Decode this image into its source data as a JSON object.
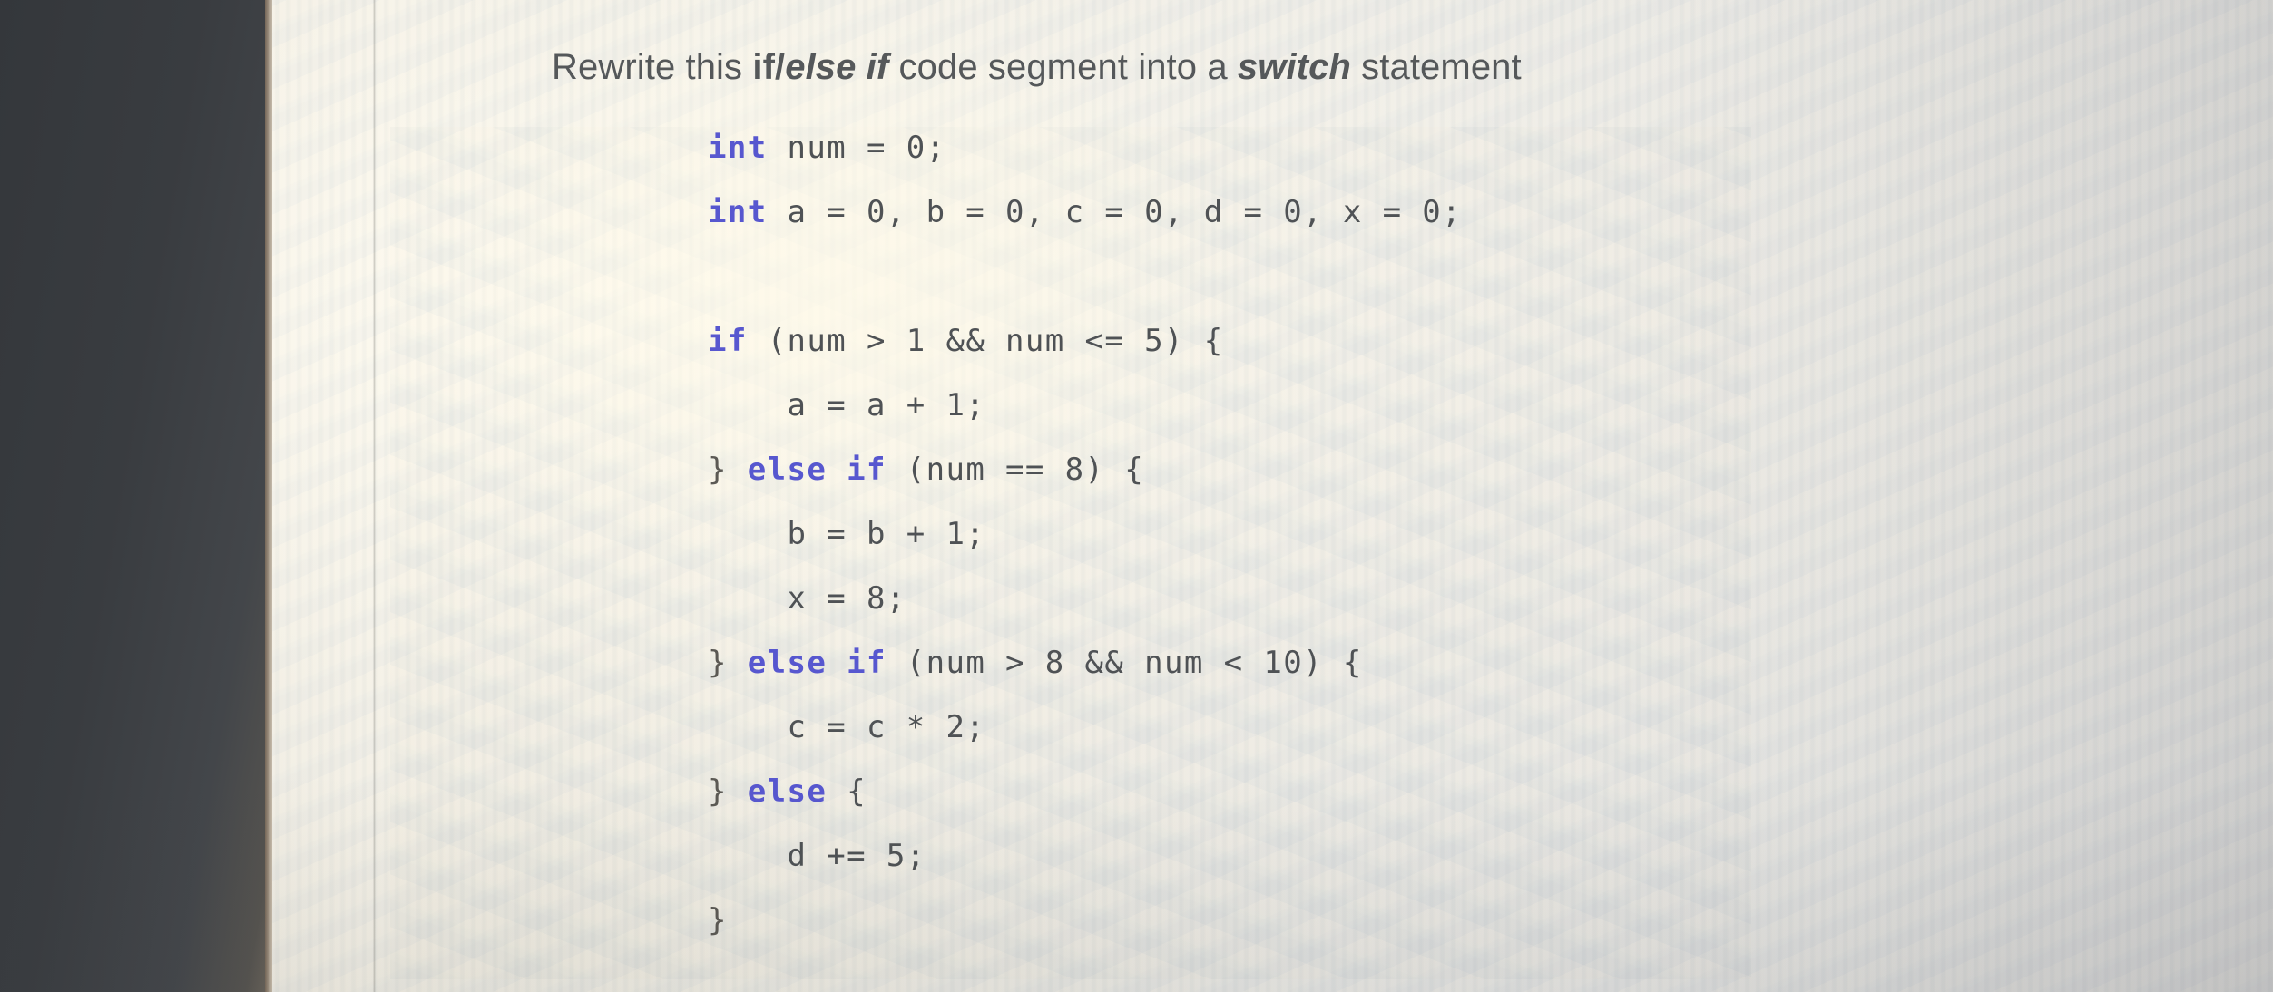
{
  "document": {
    "kind": "photo-of-screen-code-question",
    "question": {
      "prefix": "Rewrite this ",
      "kw1": "if",
      "slash": "/",
      "kw2": "else if",
      "middle": " code segment into a ",
      "kw3": "switch",
      "suffix": " statement"
    },
    "code": {
      "language": "java",
      "lines": [
        {
          "indent": 0,
          "segments": [
            {
              "t": "int",
              "c": "kw"
            },
            {
              "t": " num = 0;",
              "c": "tok"
            }
          ]
        },
        {
          "indent": 0,
          "segments": [
            {
              "t": "int",
              "c": "kw"
            },
            {
              "t": " a = 0, b = 0, c = 0, d = 0, x = 0;",
              "c": "tok"
            }
          ]
        },
        {
          "indent": 0,
          "segments": []
        },
        {
          "indent": 0,
          "segments": [
            {
              "t": "if",
              "c": "kw"
            },
            {
              "t": " (num > 1 && num <= 5) {",
              "c": "tok"
            }
          ]
        },
        {
          "indent": 4,
          "segments": [
            {
              "t": "a = a + 1;",
              "c": "tok"
            }
          ]
        },
        {
          "indent": 0,
          "segments": [
            {
              "t": "}",
              "c": "brace"
            },
            {
              "t": " ",
              "c": "tok"
            },
            {
              "t": "else if",
              "c": "kw"
            },
            {
              "t": " (num == 8) {",
              "c": "tok"
            }
          ]
        },
        {
          "indent": 4,
          "segments": [
            {
              "t": "b = b + 1;",
              "c": "tok"
            }
          ]
        },
        {
          "indent": 4,
          "segments": [
            {
              "t": "x = 8;",
              "c": "tok"
            }
          ]
        },
        {
          "indent": 0,
          "segments": [
            {
              "t": "}",
              "c": "brace"
            },
            {
              "t": " ",
              "c": "tok"
            },
            {
              "t": "else if",
              "c": "kw"
            },
            {
              "t": " (num > 8 && num < 10) {",
              "c": "tok"
            }
          ]
        },
        {
          "indent": 4,
          "segments": [
            {
              "t": "c = c * 2;",
              "c": "tok"
            }
          ]
        },
        {
          "indent": 0,
          "segments": [
            {
              "t": "}",
              "c": "brace"
            },
            {
              "t": " ",
              "c": "tok"
            },
            {
              "t": "else",
              "c": "kw"
            },
            {
              "t": " {",
              "c": "tok"
            }
          ]
        },
        {
          "indent": 4,
          "segments": [
            {
              "t": "d += 5;",
              "c": "tok"
            }
          ]
        },
        {
          "indent": 0,
          "segments": [
            {
              "t": "}",
              "c": "brace"
            }
          ]
        }
      ]
    },
    "colors": {
      "keyword": "#5757cf",
      "code_text": "#4f5255",
      "title_text": "#55585a",
      "brace": "#5b5954",
      "page_background": "#eceae3",
      "dark_panel": "#393c40"
    }
  }
}
